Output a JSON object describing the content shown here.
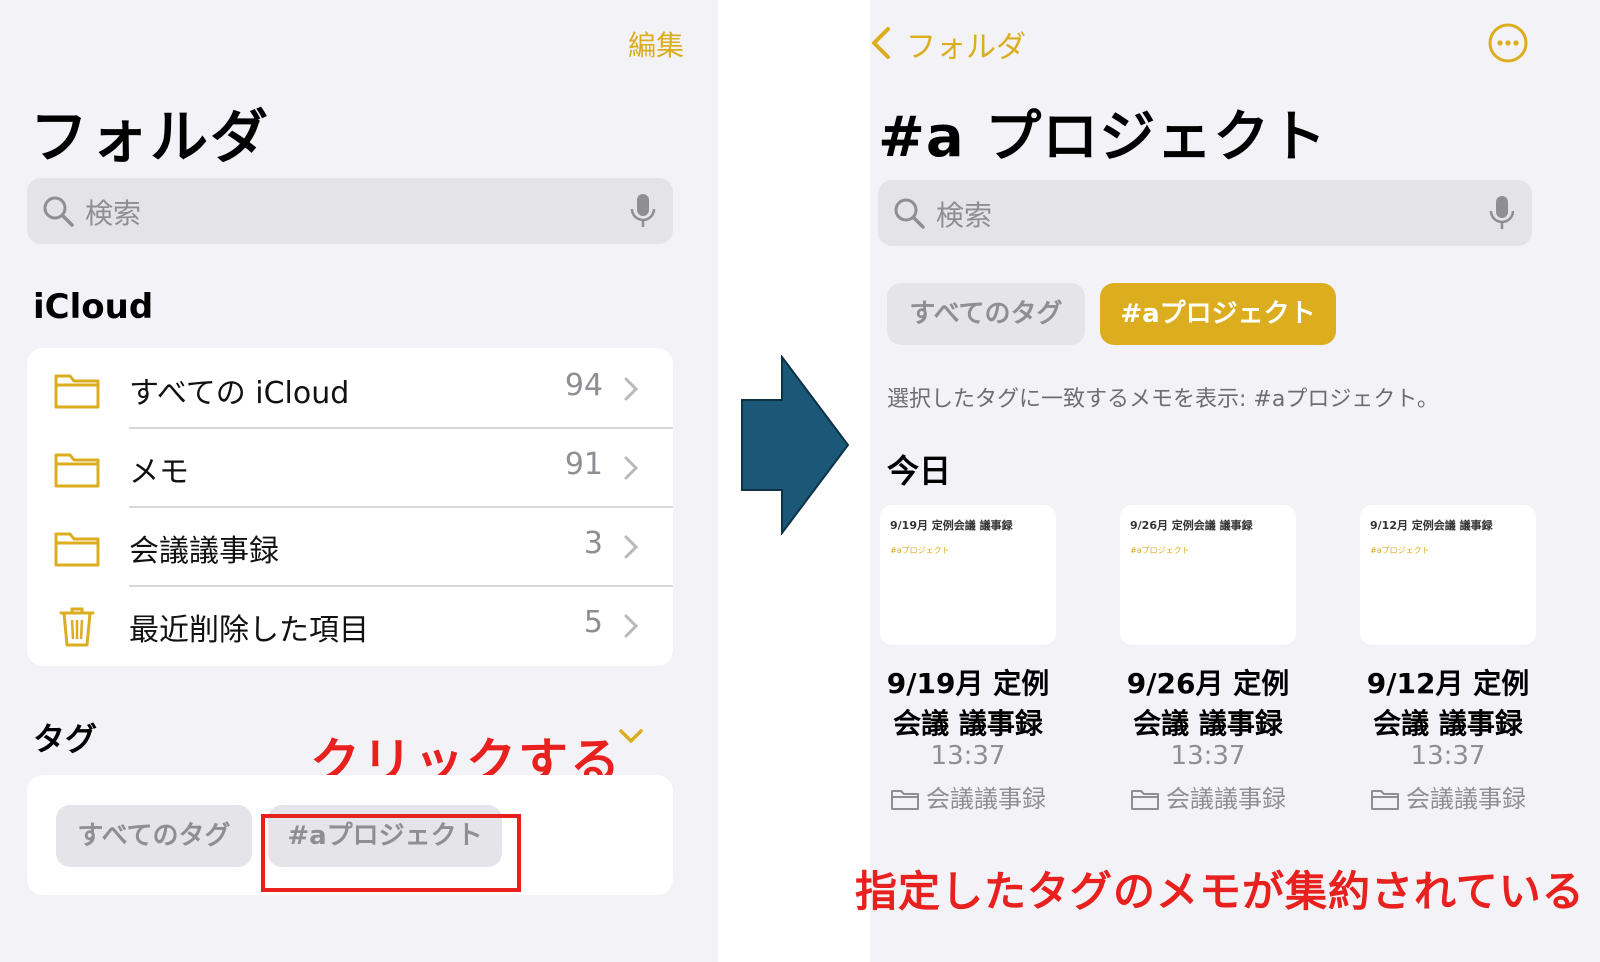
{
  "left": {
    "edit_label": "編集",
    "title": "フォルダ",
    "search_placeholder": "検索",
    "icloud_section": "iCloud",
    "folders": [
      {
        "label": "すべての iCloud",
        "count": "94",
        "icon": "folder-icon"
      },
      {
        "label": "メモ",
        "count": "91",
        "icon": "folder-icon"
      },
      {
        "label": "会議議事録",
        "count": "3",
        "icon": "folder-icon"
      },
      {
        "label": "最近削除した項目",
        "count": "5",
        "icon": "trash-icon"
      }
    ],
    "tags_section": "タグ",
    "tags": [
      "すべてのタグ",
      "#aプロジェクト"
    ],
    "annotation": "クリックする"
  },
  "right": {
    "back_label": "フォルダ",
    "title": "#a プロジェクト",
    "search_placeholder": "検索",
    "tags": [
      "すべてのタグ",
      "#aプロジェクト"
    ],
    "filter_text": "選択したタグに一致するメモを表示: #aプロジェクト。",
    "today_section": "今日",
    "notes": [
      {
        "thumb_title": "9/19月 定例会議 議事録",
        "thumb_tag": "#aプロジェクト",
        "title_line1": "9/19月 定例",
        "title_line2": "会議 議事録",
        "time": "13:37",
        "folder": "会議議事録"
      },
      {
        "thumb_title": "9/26月 定例会議 議事録",
        "thumb_tag": "#aプロジェクト",
        "title_line1": "9/26月 定例",
        "title_line2": "会議 議事録",
        "time": "13:37",
        "folder": "会議議事録"
      },
      {
        "thumb_title": "9/12月 定例会議 議事録",
        "thumb_tag": "#aプロジェクト",
        "title_line1": "9/12月 定例",
        "title_line2": "会議 議事録",
        "time": "13:37",
        "folder": "会議議事録"
      }
    ],
    "annotation": "指定したタグのメモが集約されている"
  },
  "colors": {
    "accent": "#dbad1f",
    "annotation_red": "#e8201e",
    "arrow_fill": "#1b5777",
    "background": "#f2f2f7"
  },
  "icons": [
    "search-icon",
    "microphone-icon",
    "folder-icon",
    "trash-icon",
    "chevron-right-icon",
    "chevron-down-icon",
    "chevron-left-icon",
    "more-icon",
    "arrow-right-icon"
  ]
}
